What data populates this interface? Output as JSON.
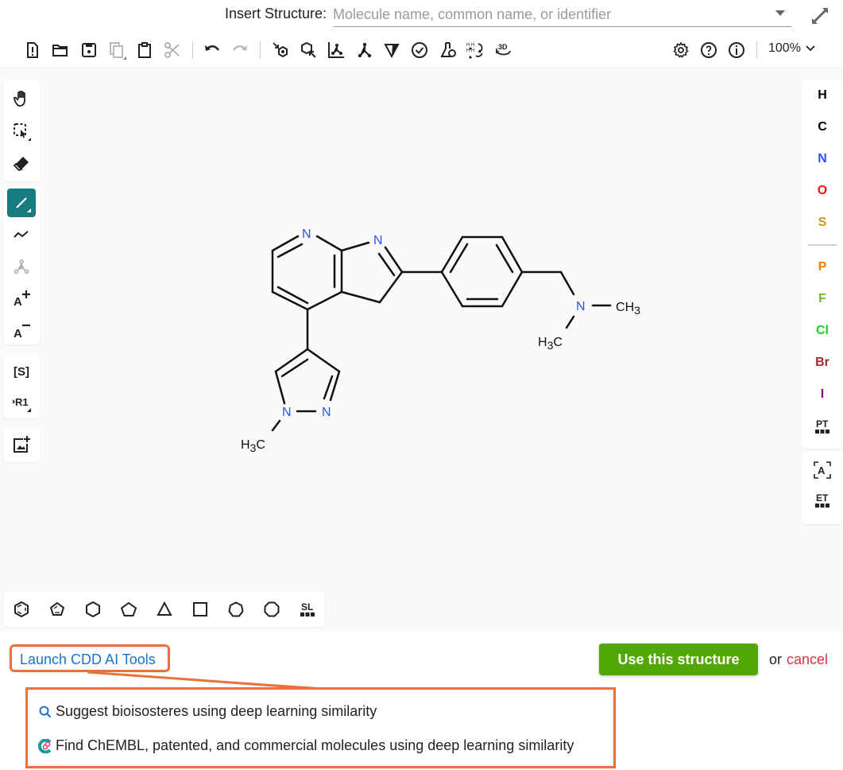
{
  "header": {
    "insert_label": "Insert Structure:",
    "insert_placeholder": "Molecule name, common name, or identifier",
    "insert_value": ""
  },
  "toolbar": {
    "left_buttons": [
      "clear-canvas",
      "open",
      "save",
      "copy",
      "paste",
      "cut",
      "undo",
      "redo"
    ],
    "middle_buttons": [
      "layout",
      "clean",
      "aromatize",
      "dearomatize",
      "stereo",
      "check",
      "analyse",
      "add-remove-hydrogens",
      "3d-viewer"
    ],
    "right_buttons": [
      "settings",
      "help",
      "about"
    ],
    "zoom": "100%"
  },
  "left_tools": [
    "hand",
    "select",
    "erase",
    "single-bond",
    "chain",
    "template-fg",
    "charge-plus",
    "charge-minus",
    "sgroup",
    "rgroup",
    "image"
  ],
  "left_tool_labels": {
    "sgroup": "[S]",
    "rgroup": "R1",
    "charge_plus": "A+",
    "charge_minus": "A−"
  },
  "atoms": [
    {
      "symbol": "H",
      "color": "#000000"
    },
    {
      "symbol": "C",
      "color": "#000000"
    },
    {
      "symbol": "N",
      "color": "#304ff7"
    },
    {
      "symbol": "O",
      "color": "#ff0d0d"
    },
    {
      "symbol": "S",
      "color": "#c99a1e"
    },
    {
      "symbol": "P",
      "color": "#ff8000"
    },
    {
      "symbol": "F",
      "color": "#78b73c"
    },
    {
      "symbol": "Cl",
      "color": "#1fd01f"
    },
    {
      "symbol": "Br",
      "color": "#a62929"
    },
    {
      "symbol": "I",
      "color": "#940094"
    },
    {
      "symbol": "PT",
      "color": "#222222"
    }
  ],
  "extra_tools": [
    "[A]",
    "ET"
  ],
  "templates": [
    "benzene",
    "cyclopentadiene",
    "cyclohexane",
    "cyclopentane",
    "cyclopropane",
    "cyclobutane",
    "cycloheptane",
    "cyclooctane",
    "SL"
  ],
  "molecule": {
    "atom_labels": {
      "pyridine_N": "N",
      "pyrrole_N": "N",
      "pyrazole_N1": "N",
      "pyrazole_N2": "N",
      "amine_N": "N",
      "methyl_pyrazole": "H3C",
      "methyl_amine_right": "CH3",
      "methyl_amine_left": "H3C"
    },
    "heteroatom_color": "#304ff7"
  },
  "bottom": {
    "launch_label": "Launch CDD AI Tools",
    "menu_items": [
      "Suggest bioisosteres using deep learning similarity",
      "Find ChEMBL, patented, and commercial molecules using deep learning similarity"
    ],
    "use_button": "Use this structure",
    "or_text": "or",
    "cancel_label": "cancel"
  },
  "colors": {
    "accent_teal": "#167c80",
    "use_green": "#52a702",
    "highlight_orange": "#e8733a",
    "link_blue": "#1a73c8",
    "cancel_red": "#e0323c"
  }
}
